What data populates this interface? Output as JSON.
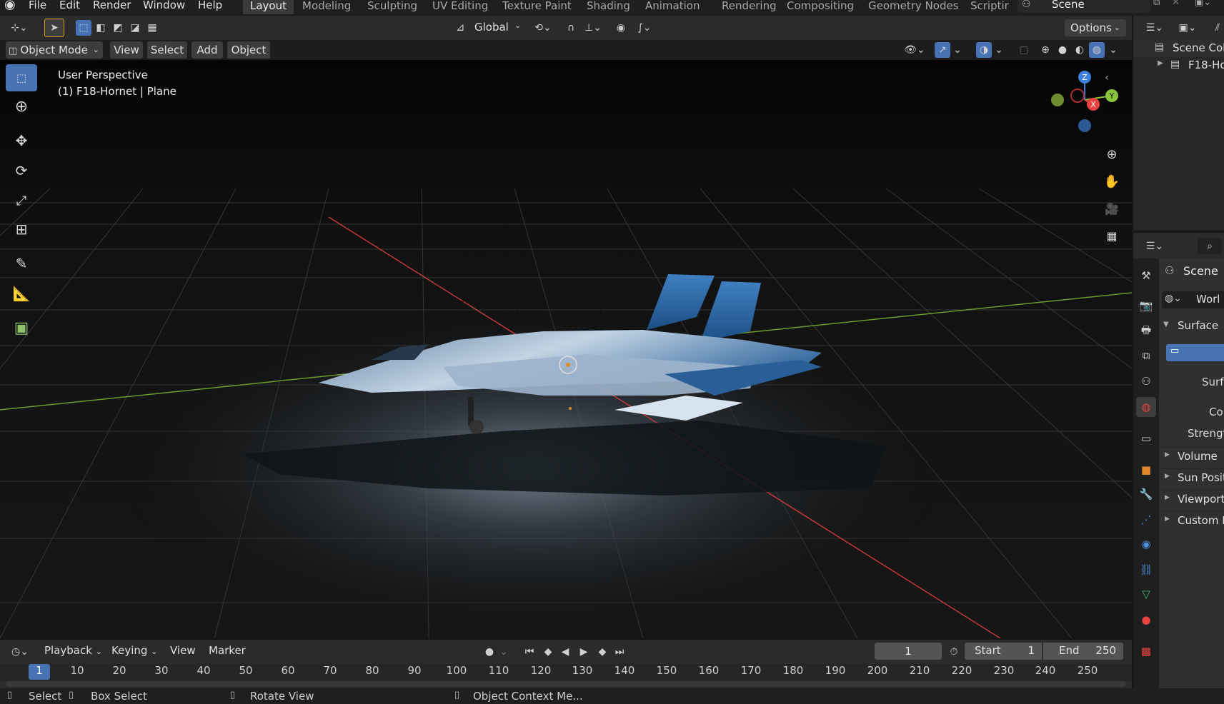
{
  "menu": [
    "File",
    "Edit",
    "Render",
    "Window",
    "Help"
  ],
  "workspaces": [
    "Layout",
    "Modeling",
    "Sculpting",
    "UV Editing",
    "Texture Paint",
    "Shading",
    "Animation",
    "Rendering",
    "Compositing",
    "Geometry Nodes",
    "Scriptir"
  ],
  "scene_name": "Scene",
  "toolbar": {
    "orientation": "Global",
    "options": "Options"
  },
  "viewport_header": {
    "mode": "Object Mode",
    "menus": [
      "View",
      "Select",
      "Add",
      "Object"
    ]
  },
  "viewport": {
    "perspective": "User Perspective",
    "object_info": "(1) F18-Hornet | Plane",
    "gizmo_axes": {
      "z": "Z",
      "y": "Y",
      "x": "X"
    }
  },
  "outliner": {
    "items": [
      "Scene Coll",
      "F18-Ho"
    ]
  },
  "properties": {
    "scene_label": "Scene",
    "world_label": "Worl",
    "surface_panel": "Surface",
    "surface_field": "Surfac",
    "color_field": "Colo",
    "strength_field": "Strengt",
    "collapsed_panels": [
      "Volume",
      "Sun Posit",
      "Viewport",
      "Custom P"
    ]
  },
  "timeline": {
    "menus": [
      "Playback",
      "Keying",
      "View",
      "Marker"
    ],
    "current_frame": "1",
    "start_label": "Start",
    "start_value": "1",
    "end_label": "End",
    "end_value": "250",
    "frame_ticks": [
      "1",
      "10",
      "20",
      "30",
      "40",
      "50",
      "60",
      "70",
      "80",
      "90",
      "100",
      "110",
      "120",
      "130",
      "140",
      "150",
      "160",
      "170",
      "180",
      "190",
      "200",
      "210",
      "220",
      "230",
      "240",
      "250"
    ]
  },
  "statusbar": {
    "select": "Select",
    "box_select": "Box Select",
    "rotate_view": "Rotate View",
    "context_menu": "Object Context Me..."
  },
  "colors": {
    "accent": "#4772b3",
    "x_axis": "#e8433f",
    "y_axis": "#8ac43a",
    "z_axis": "#3d7fd9"
  }
}
